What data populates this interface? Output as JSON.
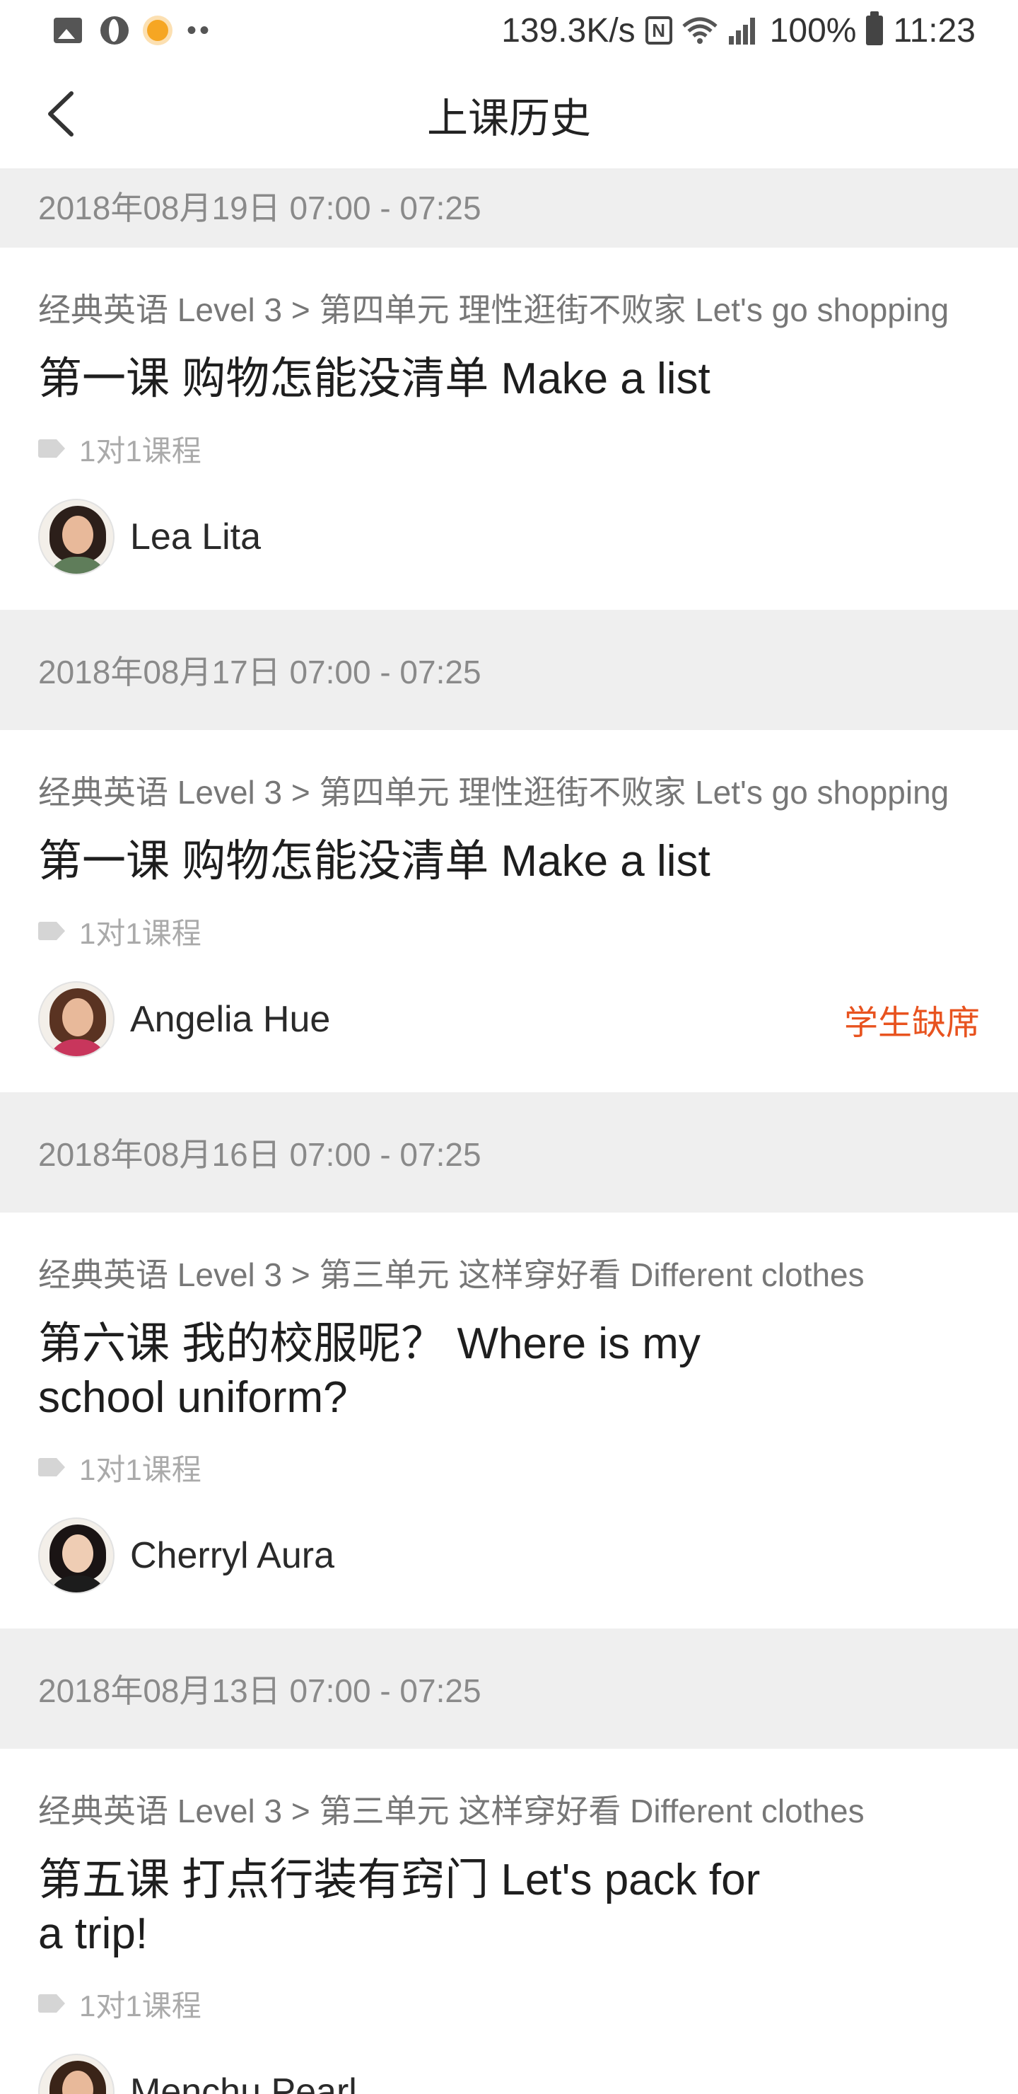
{
  "status_bar": {
    "network_speed": "139.3K/s",
    "nfc_label": "N",
    "battery_percent": "100%",
    "time": "11:23"
  },
  "header": {
    "title": "上课历史",
    "back_icon": "chevron-left-icon"
  },
  "sessions": [
    {
      "date": "2018年08月19日 07:00 - 07:25",
      "breadcrumb": "经典英语 Level 3 > 第四单元 理性逛街不败家 Let's go shopping",
      "title": "第一课 购物怎能没清单 Make a list",
      "tag": "1对1课程",
      "teacher": "Lea Lita",
      "status": ""
    },
    {
      "date": "2018年08月17日 07:00 - 07:25",
      "breadcrumb": "经典英语 Level 3 > 第四单元 理性逛街不败家 Let's go shopping",
      "title": "第一课 购物怎能没清单 Make a list",
      "tag": "1对1课程",
      "teacher": "Angelia Hue",
      "status": "学生缺席"
    },
    {
      "date": "2018年08月16日 07:00 - 07:25",
      "breadcrumb": "经典英语 Level 3 > 第三单元 这样穿好看 Different clothes",
      "title": "第六课 我的校服呢？ Where is my school uniform?",
      "tag": "1对1课程",
      "teacher": "Cherryl Aura",
      "status": ""
    },
    {
      "date": "2018年08月13日 07:00 - 07:25",
      "breadcrumb": "经典英语 Level 3 > 第三单元 这样穿好看 Different clothes",
      "title": "第五课 打点行装有窍门 Let's pack for a trip!",
      "tag": "1对1课程",
      "teacher": "Menchu Pearl",
      "status": ""
    }
  ],
  "colors": {
    "accent_status": "#e8531f",
    "divider_bg": "#efefef"
  }
}
